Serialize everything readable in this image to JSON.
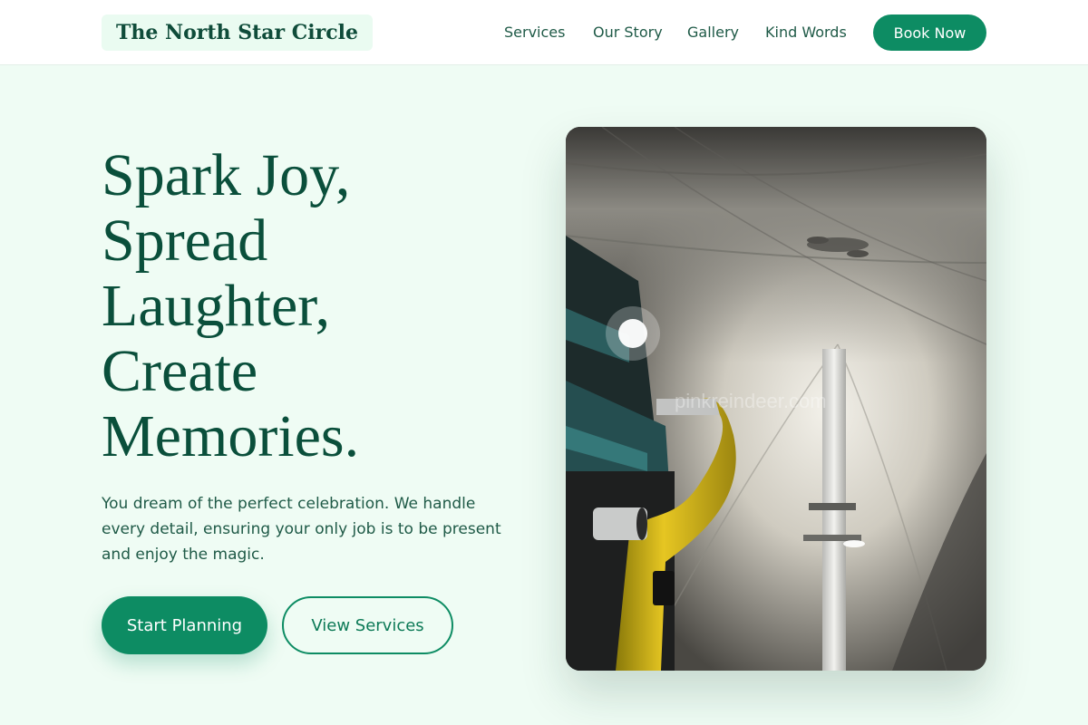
{
  "header": {
    "logo": "The North Star Circle",
    "nav": [
      "Services",
      "Our Story",
      "Gallery",
      "Kind Words"
    ],
    "cta": "Book Now"
  },
  "hero": {
    "headline": [
      "Spark Joy,",
      "Spread",
      "Laughter,",
      "Create",
      "Memories."
    ],
    "lede": "You dream of the perfect celebration. We handle every detail, ensuring your only job is to be present and enjoy the magic.",
    "primary_button": "Start Planning",
    "secondary_button": "View Services"
  },
  "image": {
    "watermark": "pinkreindeer.com",
    "subject": "tent ceiling interior with yellow duct and lights"
  },
  "colors": {
    "brand_green": "#0d8c63",
    "heading_green": "#0a4f3b",
    "page_bg": "#effcf4"
  }
}
